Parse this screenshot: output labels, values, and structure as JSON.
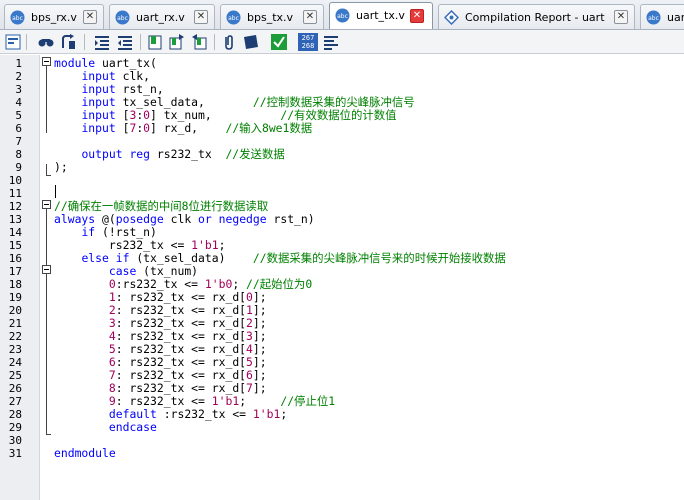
{
  "tabs": [
    {
      "label": "bps_rx.v",
      "active": false,
      "closable": true
    },
    {
      "label": "uart_rx.v",
      "active": false,
      "closable": true
    },
    {
      "label": "bps_tx.v",
      "active": false,
      "closable": true
    },
    {
      "label": "uart_tx.v",
      "active": true,
      "closable": true
    },
    {
      "label": "Compilation Report - uart",
      "active": false,
      "closable": true
    },
    {
      "label": "uar",
      "active": false,
      "closable": false
    }
  ],
  "toolbar": {
    "counter_label": "267\n268",
    "buttons": [
      "insert-template-icon",
      "find-icon",
      "find-next-icon",
      "indent-icon",
      "unindent-icon",
      "bookmark-icon",
      "next-bookmark-icon",
      "previous-bookmark-icon",
      "attach-icon",
      "comment-icon",
      "check-icon",
      "line-numbers-icon",
      "align-icon"
    ]
  },
  "colors": {
    "keyword": "#0000ff",
    "number": "#a0005a",
    "comment": "#008000",
    "text": "#000000",
    "active_close": "#e53b3b"
  },
  "code_lines": [
    [
      [
        "kw",
        "module "
      ],
      [
        "tx",
        "uart_tx("
      ]
    ],
    [
      [
        "tx",
        "    "
      ],
      [
        "kw",
        "input "
      ],
      [
        "tx",
        "clk,"
      ]
    ],
    [
      [
        "tx",
        "    "
      ],
      [
        "kw",
        "input "
      ],
      [
        "tx",
        "rst_n,"
      ]
    ],
    [
      [
        "tx",
        "    "
      ],
      [
        "kw",
        "input "
      ],
      [
        "tx",
        "tx_sel_data,       "
      ],
      [
        "cm",
        "//控制数据采集的尖峰脉冲信号"
      ]
    ],
    [
      [
        "tx",
        "    "
      ],
      [
        "kw",
        "input "
      ],
      [
        "tx",
        "["
      ],
      [
        "num",
        "3"
      ],
      [
        "tx",
        ":"
      ],
      [
        "num",
        "0"
      ],
      [
        "tx",
        "] tx_num,          "
      ],
      [
        "cm",
        "//有效数据位的计数值"
      ]
    ],
    [
      [
        "tx",
        "    "
      ],
      [
        "kw",
        "input "
      ],
      [
        "tx",
        "["
      ],
      [
        "num",
        "7"
      ],
      [
        "tx",
        ":"
      ],
      [
        "num",
        "0"
      ],
      [
        "tx",
        "] rx_d,    "
      ],
      [
        "cm",
        "//输入8we1数据"
      ]
    ],
    [],
    [
      [
        "tx",
        "    "
      ],
      [
        "kw",
        "output reg "
      ],
      [
        "tx",
        "rs232_tx  "
      ],
      [
        "cm",
        "//发送数据"
      ]
    ],
    [
      [
        "tx",
        ");"
      ]
    ],
    [],
    [],
    [
      [
        "cm",
        "//确保在一帧数据的中间8位进行数据读取"
      ]
    ],
    [
      [
        "kw",
        "always "
      ],
      [
        "tx",
        "@("
      ],
      [
        "kw",
        "posedge "
      ],
      [
        "tx",
        "clk "
      ],
      [
        "kw",
        "or negedge "
      ],
      [
        "tx",
        "rst_n)"
      ]
    ],
    [
      [
        "tx",
        "    "
      ],
      [
        "kw",
        "if "
      ],
      [
        "tx",
        "(!rst_n)"
      ]
    ],
    [
      [
        "tx",
        "        rs232_tx <= "
      ],
      [
        "num",
        "1'b1"
      ],
      [
        "tx",
        ";"
      ]
    ],
    [
      [
        "tx",
        "    "
      ],
      [
        "kw",
        "else if "
      ],
      [
        "tx",
        "(tx_sel_data)    "
      ],
      [
        "cm",
        "//数据采集的尖峰脉冲信号来的时候开始接收数据"
      ]
    ],
    [
      [
        "tx",
        "        "
      ],
      [
        "kw",
        "case "
      ],
      [
        "tx",
        "(tx_num)"
      ]
    ],
    [
      [
        "tx",
        "        "
      ],
      [
        "num",
        "0"
      ],
      [
        "tx",
        ":rs232_tx <= "
      ],
      [
        "num",
        "1'b0"
      ],
      [
        "tx",
        "; "
      ],
      [
        "cm",
        "//起始位为0"
      ]
    ],
    [
      [
        "tx",
        "        "
      ],
      [
        "num",
        "1"
      ],
      [
        "tx",
        ": rs232_tx <= rx_d["
      ],
      [
        "num",
        "0"
      ],
      [
        "tx",
        "];"
      ]
    ],
    [
      [
        "tx",
        "        "
      ],
      [
        "num",
        "2"
      ],
      [
        "tx",
        ": rs232_tx <= rx_d["
      ],
      [
        "num",
        "1"
      ],
      [
        "tx",
        "];"
      ]
    ],
    [
      [
        "tx",
        "        "
      ],
      [
        "num",
        "3"
      ],
      [
        "tx",
        ": rs232_tx <= rx_d["
      ],
      [
        "num",
        "2"
      ],
      [
        "tx",
        "];"
      ]
    ],
    [
      [
        "tx",
        "        "
      ],
      [
        "num",
        "4"
      ],
      [
        "tx",
        ": rs232_tx <= rx_d["
      ],
      [
        "num",
        "3"
      ],
      [
        "tx",
        "];"
      ]
    ],
    [
      [
        "tx",
        "        "
      ],
      [
        "num",
        "5"
      ],
      [
        "tx",
        ": rs232_tx <= rx_d["
      ],
      [
        "num",
        "4"
      ],
      [
        "tx",
        "];"
      ]
    ],
    [
      [
        "tx",
        "        "
      ],
      [
        "num",
        "6"
      ],
      [
        "tx",
        ": rs232_tx <= rx_d["
      ],
      [
        "num",
        "5"
      ],
      [
        "tx",
        "];"
      ]
    ],
    [
      [
        "tx",
        "        "
      ],
      [
        "num",
        "7"
      ],
      [
        "tx",
        ": rs232_tx <= rx_d["
      ],
      [
        "num",
        "6"
      ],
      [
        "tx",
        "];"
      ]
    ],
    [
      [
        "tx",
        "        "
      ],
      [
        "num",
        "8"
      ],
      [
        "tx",
        ": rs232_tx <= rx_d["
      ],
      [
        "num",
        "7"
      ],
      [
        "tx",
        "];"
      ]
    ],
    [
      [
        "tx",
        "        "
      ],
      [
        "num",
        "9"
      ],
      [
        "tx",
        ": rs232_tx <= "
      ],
      [
        "num",
        "1'b1"
      ],
      [
        "tx",
        ";     "
      ],
      [
        "cm",
        "//停止位1"
      ]
    ],
    [
      [
        "tx",
        "        "
      ],
      [
        "kw",
        "default "
      ],
      [
        "tx",
        ":rs232_tx <= "
      ],
      [
        "num",
        "1'b1"
      ],
      [
        "tx",
        ";"
      ]
    ],
    [
      [
        "tx",
        "        "
      ],
      [
        "kw",
        "endcase"
      ]
    ],
    [],
    [
      [
        "kw",
        "endmodule"
      ]
    ]
  ],
  "line_numbers": [
    "1",
    "2",
    "3",
    "4",
    "5",
    "6",
    "7",
    "8",
    "9",
    "10",
    "11",
    "12",
    "13",
    "14",
    "15",
    "16",
    "17",
    "18",
    "19",
    "20",
    "21",
    "22",
    "23",
    "24",
    "25",
    "26",
    "27",
    "28",
    "29",
    "30",
    "31"
  ]
}
